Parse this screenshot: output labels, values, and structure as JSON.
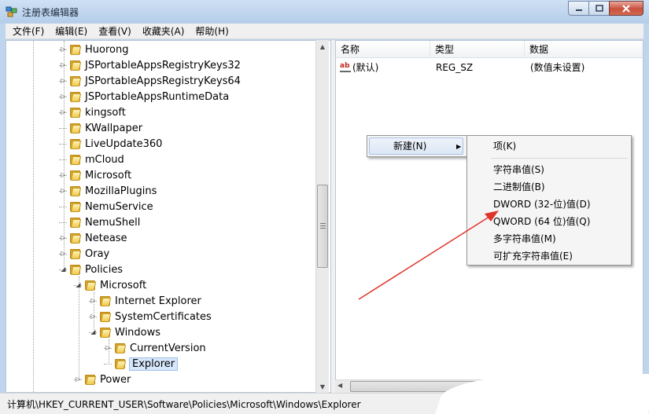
{
  "window": {
    "title": "注册表编辑器",
    "controls": [
      "minimize",
      "maximize",
      "close"
    ]
  },
  "menubar": {
    "items": [
      "文件(F)",
      "编辑(E)",
      "查看(V)",
      "收藏夹(A)",
      "帮助(H)"
    ]
  },
  "tree": {
    "items": [
      {
        "label": "Huorong"
      },
      {
        "label": "JSPortableAppsRegistryKeys32"
      },
      {
        "label": "JSPortableAppsRegistryKeys64"
      },
      {
        "label": "JSPortableAppsRuntimeData"
      },
      {
        "label": "kingsoft"
      },
      {
        "label": "KWallpaper"
      },
      {
        "label": "LiveUpdate360"
      },
      {
        "label": "mCloud"
      },
      {
        "label": "Microsoft"
      },
      {
        "label": "MozillaPlugins"
      },
      {
        "label": "NemuService"
      },
      {
        "label": "NemuShell"
      },
      {
        "label": "Netease"
      },
      {
        "label": "Oray"
      },
      {
        "label": "Policies"
      },
      {
        "label": "Microsoft"
      },
      {
        "label": "Internet Explorer"
      },
      {
        "label": "SystemCertificates"
      },
      {
        "label": "Windows"
      },
      {
        "label": "CurrentVersion"
      },
      {
        "label": "Explorer"
      },
      {
        "label": "Power"
      }
    ],
    "selected": "Explorer"
  },
  "list": {
    "columns": [
      "名称",
      "类型",
      "数据"
    ],
    "rows": [
      {
        "name": "(默认)",
        "type": "REG_SZ",
        "data": "(数值未设置)",
        "icon": "string-value-icon"
      }
    ]
  },
  "context_menu": {
    "new_item": "新建(N)",
    "new_mnemonic": "N"
  },
  "submenu": {
    "items": [
      {
        "label": "项(K)"
      },
      {
        "label": "字符串值(S)"
      },
      {
        "label": "二进制值(B)"
      },
      {
        "label": "DWORD (32-位)值(D)"
      },
      {
        "label": "QWORD (64 位)值(Q)"
      },
      {
        "label": "多字符串值(M)"
      },
      {
        "label": "可扩充字符串值(E)"
      }
    ]
  },
  "statusbar": {
    "path": "计算机\\HKEY_CURRENT_USER\\Software\\Policies\\Microsoft\\Windows\\Explorer"
  },
  "annotation": {
    "arrow_color": "#e0342a"
  }
}
